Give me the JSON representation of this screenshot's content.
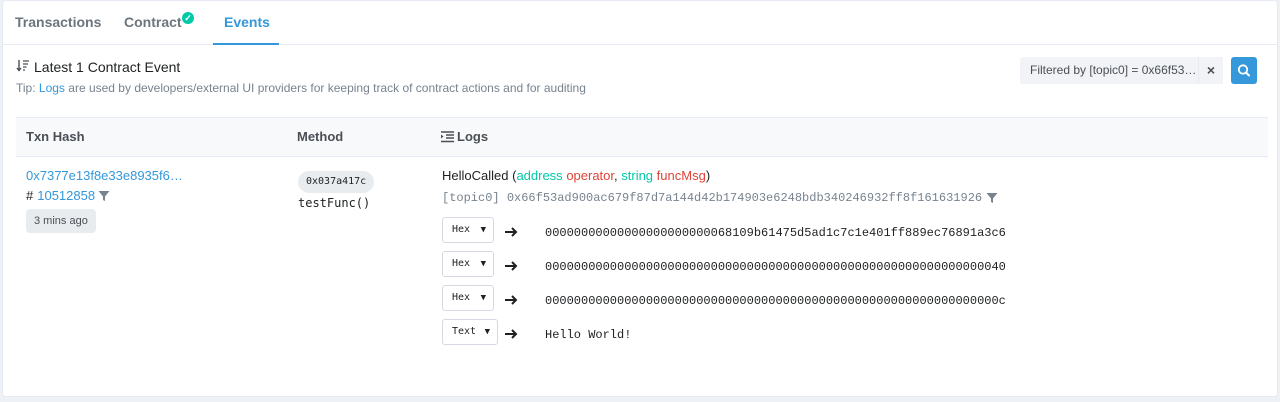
{
  "tabs": {
    "transactions": "Transactions",
    "contract": "Contract",
    "events": "Events"
  },
  "header": {
    "title": "Latest 1 Contract Event",
    "tip_prefix": "Tip: ",
    "tip_link": "Logs",
    "tip_rest": " are used by developers/external UI providers for keeping track of contract actions and for auditing"
  },
  "filter": {
    "label": "Filtered by [topic0] = 0x66f53…",
    "clear": "×"
  },
  "table": {
    "columns": {
      "txn_hash": "Txn Hash",
      "method": "Method",
      "logs": "Logs"
    }
  },
  "row": {
    "txn_hash": "0x7377e13f8e33e8935f6…",
    "block_prefix": "#",
    "block_number": "10512858",
    "age": "3 mins ago",
    "method_id": "0x037a417c",
    "method_name": "testFunc()",
    "event": {
      "name": "HelloCalled",
      "open": " (",
      "p1_type": "address",
      "p1_name": "operator",
      "sep": ", ",
      "p2_type": "string",
      "p2_name": "funcMsg",
      "close": ")"
    },
    "topic0_label": "[topic0]",
    "topic0_value": "0x66f53ad900ac679f87d7a144d42b174903e6248bdb340246932ff8f161631926",
    "data_rows": [
      {
        "format": "Hex",
        "value": "00000000000000000000000068109b61475d5ad1c7c1e401ff889ec76891a3c6"
      },
      {
        "format": "Hex",
        "value": "0000000000000000000000000000000000000000000000000000000000000040"
      },
      {
        "format": "Hex",
        "value": "000000000000000000000000000000000000000000000000000000000000000c"
      },
      {
        "format": "Text",
        "value": "Hello World!"
      }
    ]
  },
  "colors": {
    "accent": "#3498db",
    "param_type": "#00c9a7",
    "param_name": "#de4437"
  }
}
